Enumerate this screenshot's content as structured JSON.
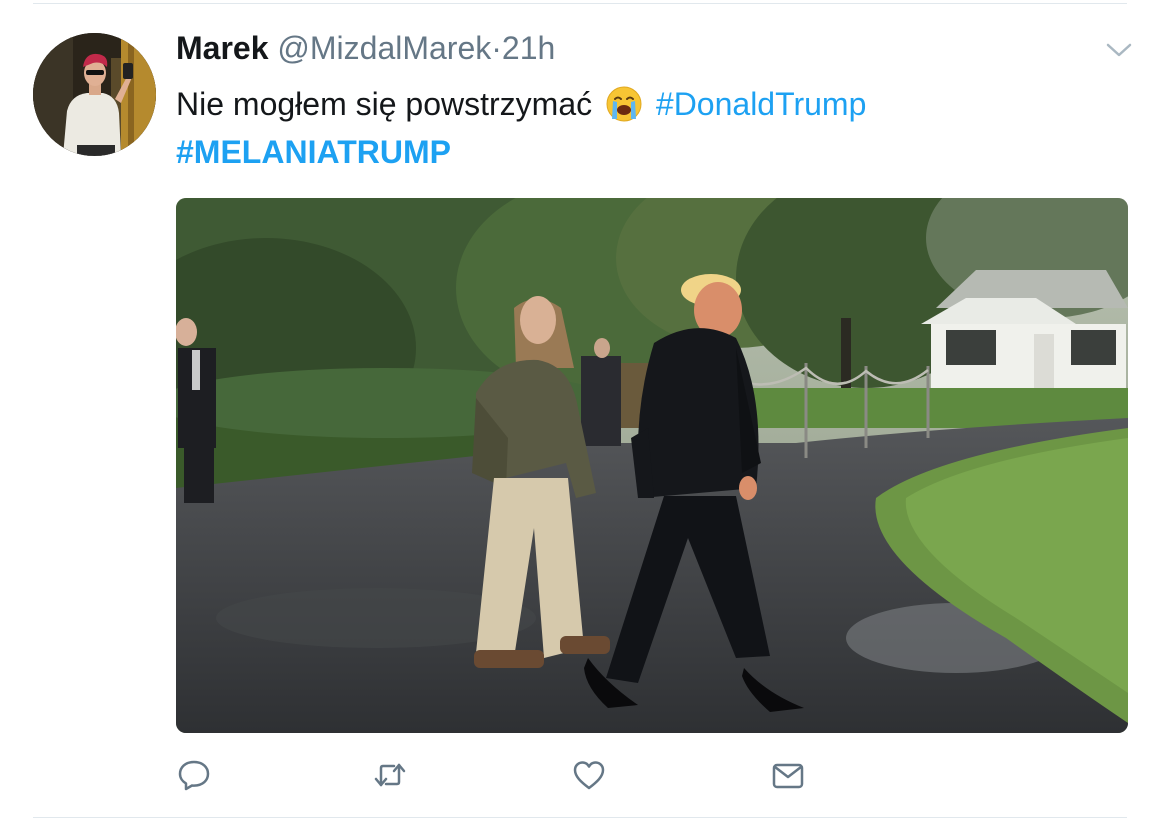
{
  "tweet": {
    "author_name": "Marek",
    "author_handle": "@MizdalMarek",
    "separator": "·",
    "time_ago": "21h",
    "text": "Nie mogłem się powstrzymać",
    "hashtags": [
      "#DonaldTrump",
      "#MELANIATRUMP"
    ]
  },
  "icons": {
    "emoji": "loudly-crying-face-emoji",
    "menu": "chevron-down-icon",
    "actions": [
      "reply-icon",
      "retweet-icon",
      "like-icon",
      "direct-message-icon"
    ]
  },
  "colors": {
    "text": "#14171a",
    "secondary": "#657786",
    "link": "#1da1f2",
    "icon": "#657786",
    "divider": "#e1e8ed"
  }
}
